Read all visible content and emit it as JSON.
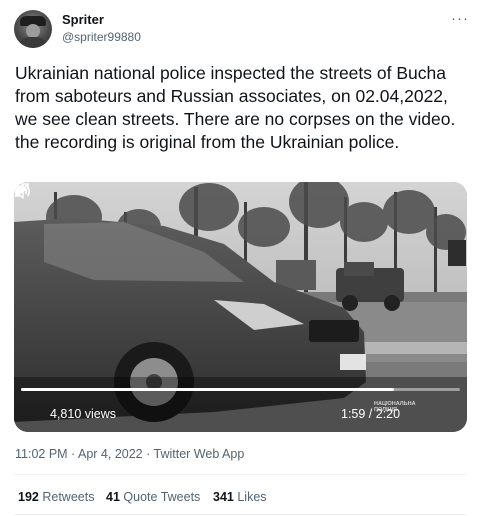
{
  "author": {
    "name": "Spriter",
    "handle": "@spriter99880",
    "avatar_icon": "profile-avatar"
  },
  "more_icon": "more-horizontal-icon",
  "tweet": {
    "text_line1": "Ukrainian national police inspected the streets of Bucha from saboteurs and Russian associates, on 02.04,2022, we see clean streets. There are no corpses on the video.",
    "text_line2": "the recording is original from the Ukrainian police."
  },
  "video": {
    "views": "4,810 views",
    "time": "1:59 / 2:20",
    "watermark": "НАЦІОНАЛЬНА ПОЛІЦІЯ",
    "progress_fraction": 0.85,
    "play_icon": "play-icon",
    "volume_icon": "volume-icon",
    "fullscreen_icon": "fullscreen-icon"
  },
  "meta": {
    "timestamp": "11:02 PM · Apr 4, 2022 · Twitter Web App"
  },
  "stats": {
    "retweets_count": "192",
    "retweets_label": "Retweets",
    "quotes_count": "41",
    "quotes_label": "Quote Tweets",
    "likes_count": "341",
    "likes_label": "Likes"
  },
  "colors": {
    "text_primary": "#0f1419",
    "text_secondary": "#536471",
    "divider": "#eff3f4"
  }
}
